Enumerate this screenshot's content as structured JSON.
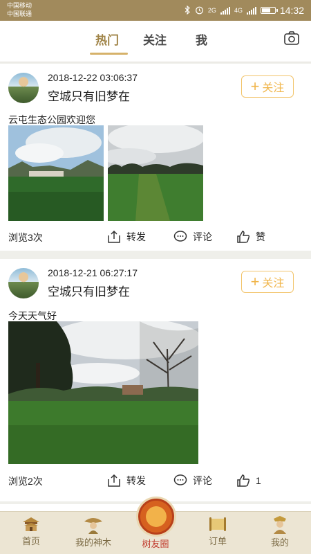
{
  "status_bar": {
    "carrier_1": "中国移动",
    "carrier_2": "中国联通",
    "network_1": "2G",
    "network_2": "4G",
    "time": "14:32"
  },
  "top_nav": {
    "tabs": [
      {
        "label": "热门",
        "active": true
      },
      {
        "label": "关注",
        "active": false
      },
      {
        "label": "我",
        "active": false
      }
    ],
    "camera_icon": "camera-icon"
  },
  "posts": [
    {
      "time": "2018-12-22 03:06:37",
      "user": "空城只有旧梦在",
      "follow_label": "关注",
      "caption": "云屯生态公园欢迎您",
      "views": "浏览3次",
      "share_label": "转发",
      "comment_label": "评论",
      "like_label": "赞"
    },
    {
      "time": "2018-12-21 06:27:17",
      "user": "空城只有旧梦在",
      "follow_label": "关注",
      "caption": "今天天气好",
      "views": "浏览2次",
      "share_label": "转发",
      "comment_label": "评论",
      "like_label": "1"
    }
  ],
  "bottom_nav": {
    "items": [
      {
        "label": "首页",
        "icon": "temple-icon"
      },
      {
        "label": "我的神木",
        "icon": "tree-character-icon"
      },
      {
        "label": "树友圈",
        "icon": "wheel-icon",
        "active": true
      },
      {
        "label": "订单",
        "icon": "scroll-icon"
      },
      {
        "label": "我的",
        "icon": "tree-god-icon"
      }
    ]
  },
  "colors": {
    "accent": "#a08448",
    "follow": "#f0b54a",
    "status_bar": "#a18a5c",
    "active_bottom": "#c0392b"
  }
}
